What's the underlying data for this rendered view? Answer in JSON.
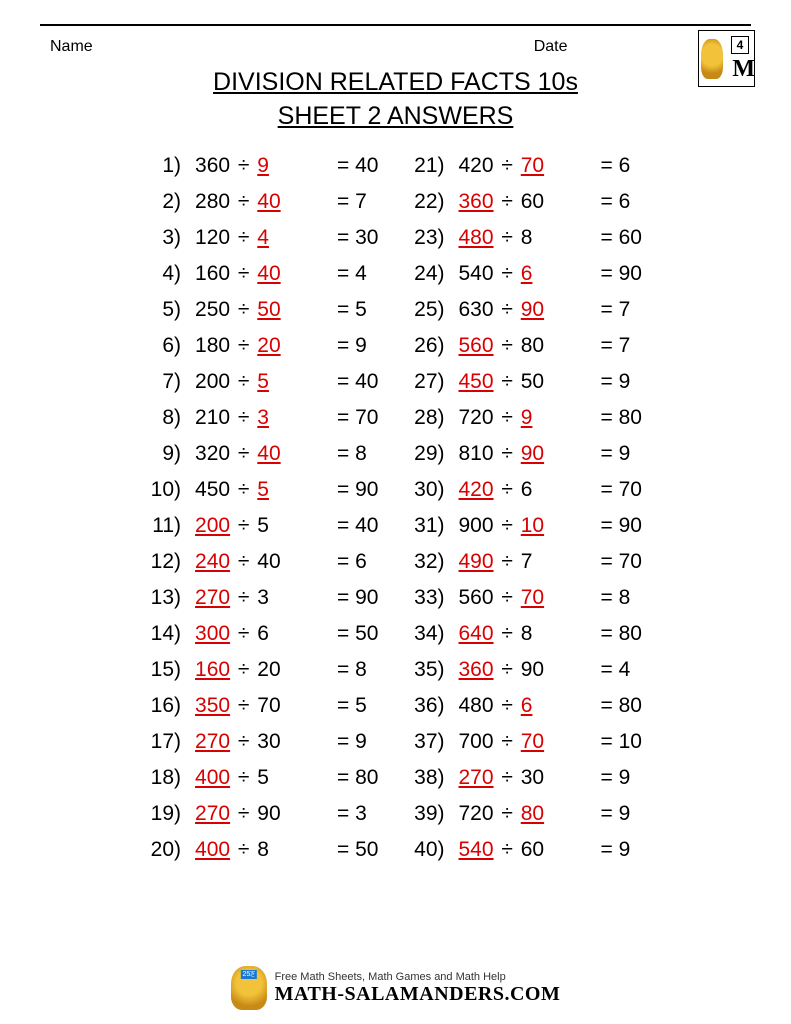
{
  "header": {
    "name_label": "Name",
    "date_label": "Date",
    "badge_number": "4"
  },
  "title_line1": "DIVISION RELATED FACTS 10s",
  "title_line2": "SHEET 2 ANSWERS",
  "division_sign": "÷",
  "equals_sign": "=",
  "problems": [
    {
      "n": "1)",
      "a": "360",
      "b": "9",
      "r": "40",
      "hi": "b"
    },
    {
      "n": "2)",
      "a": "280",
      "b": "40",
      "r": "7",
      "hi": "b"
    },
    {
      "n": "3)",
      "a": "120",
      "b": "4",
      "r": "30",
      "hi": "b"
    },
    {
      "n": "4)",
      "a": "160",
      "b": "40",
      "r": "4",
      "hi": "b"
    },
    {
      "n": "5)",
      "a": "250",
      "b": "50",
      "r": "5",
      "hi": "b"
    },
    {
      "n": "6)",
      "a": "180",
      "b": "20",
      "r": "9",
      "hi": "b"
    },
    {
      "n": "7)",
      "a": "200",
      "b": "5",
      "r": "40",
      "hi": "b"
    },
    {
      "n": "8)",
      "a": "210",
      "b": "3",
      "r": "70",
      "hi": "b"
    },
    {
      "n": "9)",
      "a": "320",
      "b": "40",
      "r": "8",
      "hi": "b"
    },
    {
      "n": "10)",
      "a": "450",
      "b": "5",
      "r": "90",
      "hi": "b"
    },
    {
      "n": "11)",
      "a": "200",
      "b": "5",
      "r": "40",
      "hi": "a"
    },
    {
      "n": "12)",
      "a": "240",
      "b": "40",
      "r": "6",
      "hi": "a"
    },
    {
      "n": "13)",
      "a": "270",
      "b": "3",
      "r": "90",
      "hi": "a"
    },
    {
      "n": "14)",
      "a": "300",
      "b": "6",
      "r": "50",
      "hi": "a"
    },
    {
      "n": "15)",
      "a": "160",
      "b": "20",
      "r": "8",
      "hi": "a"
    },
    {
      "n": "16)",
      "a": "350",
      "b": "70",
      "r": "5",
      "hi": "a"
    },
    {
      "n": "17)",
      "a": "270",
      "b": "30",
      "r": "9",
      "hi": "a"
    },
    {
      "n": "18)",
      "a": "400",
      "b": "5",
      "r": "80",
      "hi": "a"
    },
    {
      "n": "19)",
      "a": "270",
      "b": "90",
      "r": "3",
      "hi": "a"
    },
    {
      "n": "20)",
      "a": "400",
      "b": "8",
      "r": "50",
      "hi": "a"
    },
    {
      "n": "21)",
      "a": "420",
      "b": "70",
      "r": "6",
      "hi": "b"
    },
    {
      "n": "22)",
      "a": "360",
      "b": "60",
      "r": "6",
      "hi": "a"
    },
    {
      "n": "23)",
      "a": "480",
      "b": "8",
      "r": "60",
      "hi": "a"
    },
    {
      "n": "24)",
      "a": "540",
      "b": "6",
      "r": "90",
      "hi": "b"
    },
    {
      "n": "25)",
      "a": "630",
      "b": "90",
      "r": "7",
      "hi": "b"
    },
    {
      "n": "26)",
      "a": "560",
      "b": "80",
      "r": "7",
      "hi": "a"
    },
    {
      "n": "27)",
      "a": "450",
      "b": "50",
      "r": "9",
      "hi": "a"
    },
    {
      "n": "28)",
      "a": "720",
      "b": "9",
      "r": "80",
      "hi": "b"
    },
    {
      "n": "29)",
      "a": "810",
      "b": "90",
      "r": "9",
      "hi": "b"
    },
    {
      "n": "30)",
      "a": "420",
      "b": "6",
      "r": "70",
      "hi": "a"
    },
    {
      "n": "31)",
      "a": "900",
      "b": "10",
      "r": "90",
      "hi": "b"
    },
    {
      "n": "32)",
      "a": "490",
      "b": "7",
      "r": "70",
      "hi": "a"
    },
    {
      "n": "33)",
      "a": "560",
      "b": "70",
      "r": "8",
      "hi": "b"
    },
    {
      "n": "34)",
      "a": "640",
      "b": "8",
      "r": "80",
      "hi": "a"
    },
    {
      "n": "35)",
      "a": "360",
      "b": "90",
      "r": "4",
      "hi": "a"
    },
    {
      "n": "36)",
      "a": "480",
      "b": "6",
      "r": "80",
      "hi": "b"
    },
    {
      "n": "37)",
      "a": "700",
      "b": "70",
      "r": "10",
      "hi": "b"
    },
    {
      "n": "38)",
      "a": "270",
      "b": "30",
      "r": "9",
      "hi": "a"
    },
    {
      "n": "39)",
      "a": "720",
      "b": "80",
      "r": "9",
      "hi": "b"
    },
    {
      "n": "40)",
      "a": "540",
      "b": "60",
      "r": "9",
      "hi": "a"
    }
  ],
  "footer": {
    "tagline": "Free Math Sheets, Math Games and Math Help",
    "site": "MATH-SALAMANDERS.COM"
  }
}
